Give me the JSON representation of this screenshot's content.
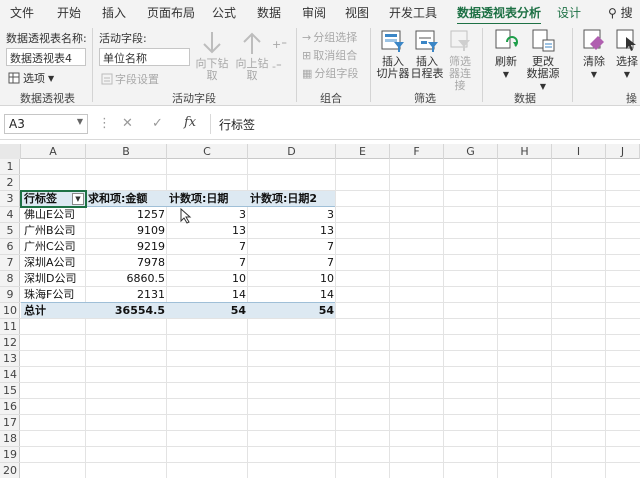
{
  "tabs": [
    {
      "label": "文件"
    },
    {
      "label": "开始"
    },
    {
      "label": "插入"
    },
    {
      "label": "页面布局"
    },
    {
      "label": "公式"
    },
    {
      "label": "数据"
    },
    {
      "label": "审阅"
    },
    {
      "label": "视图"
    },
    {
      "label": "开发工具"
    },
    {
      "label": "数据透视表分析"
    },
    {
      "label": "设计"
    },
    {
      "label": "搜"
    }
  ],
  "ribbon": {
    "pivot_table": {
      "name_label": "数据透视表名称:",
      "name_value": "数据透视表4",
      "options_label": "选项",
      "group_label": "数据透视表"
    },
    "active_field": {
      "field_label": "活动字段:",
      "field_value": "单位名称",
      "field_settings": "字段设置",
      "drill_down": "向下钻取",
      "drill_up": "向上钻",
      "drill_up_2": "取",
      "group_label": "活动字段"
    },
    "group": {
      "group_selection": "分组选择",
      "ungroup": "取消组合",
      "group_field": "分组字段",
      "group_label": "组合"
    },
    "filter": {
      "insert_slicer_1": "插入",
      "insert_slicer_2": "切片器",
      "insert_timeline_1": "插入",
      "insert_timeline_2": "日程表",
      "filter_conn_1": "筛选",
      "filter_conn_2": "器连接",
      "group_label": "筛选"
    },
    "data": {
      "refresh": "刷新",
      "change_source_1": "更改",
      "change_source_2": "数据源",
      "group_label": "数据"
    },
    "actions": {
      "clear": "清除",
      "select": "选择",
      "group_label": "操"
    }
  },
  "formula_bar": {
    "name_box": "A3",
    "fx": "fx",
    "content": "行标签"
  },
  "columns": [
    "A",
    "B",
    "C",
    "D",
    "E",
    "F",
    "G",
    "H",
    "I",
    "J"
  ],
  "rows": [
    "1",
    "2",
    "3",
    "4",
    "5",
    "6",
    "7",
    "8",
    "9",
    "10",
    "11",
    "12",
    "13",
    "14",
    "15",
    "16",
    "17",
    "18",
    "19",
    "20"
  ],
  "pivot": {
    "headers": [
      "行标签",
      "求和项:金额",
      "计数项:日期",
      "计数项:日期2"
    ],
    "rows": [
      [
        "佛山E公司",
        "1257",
        "3",
        "3"
      ],
      [
        "广州B公司",
        "9109",
        "13",
        "13"
      ],
      [
        "广州C公司",
        "9219",
        "7",
        "7"
      ],
      [
        "深圳A公司",
        "7978",
        "7",
        "7"
      ],
      [
        "深圳D公司",
        "6860.5",
        "10",
        "10"
      ],
      [
        "珠海F公司",
        "2131",
        "14",
        "14"
      ]
    ],
    "total": [
      "总计",
      "36554.5",
      "54",
      "54"
    ]
  },
  "colors": {
    "accent": "#1e7145",
    "pivot_band": "#dde9f2"
  }
}
